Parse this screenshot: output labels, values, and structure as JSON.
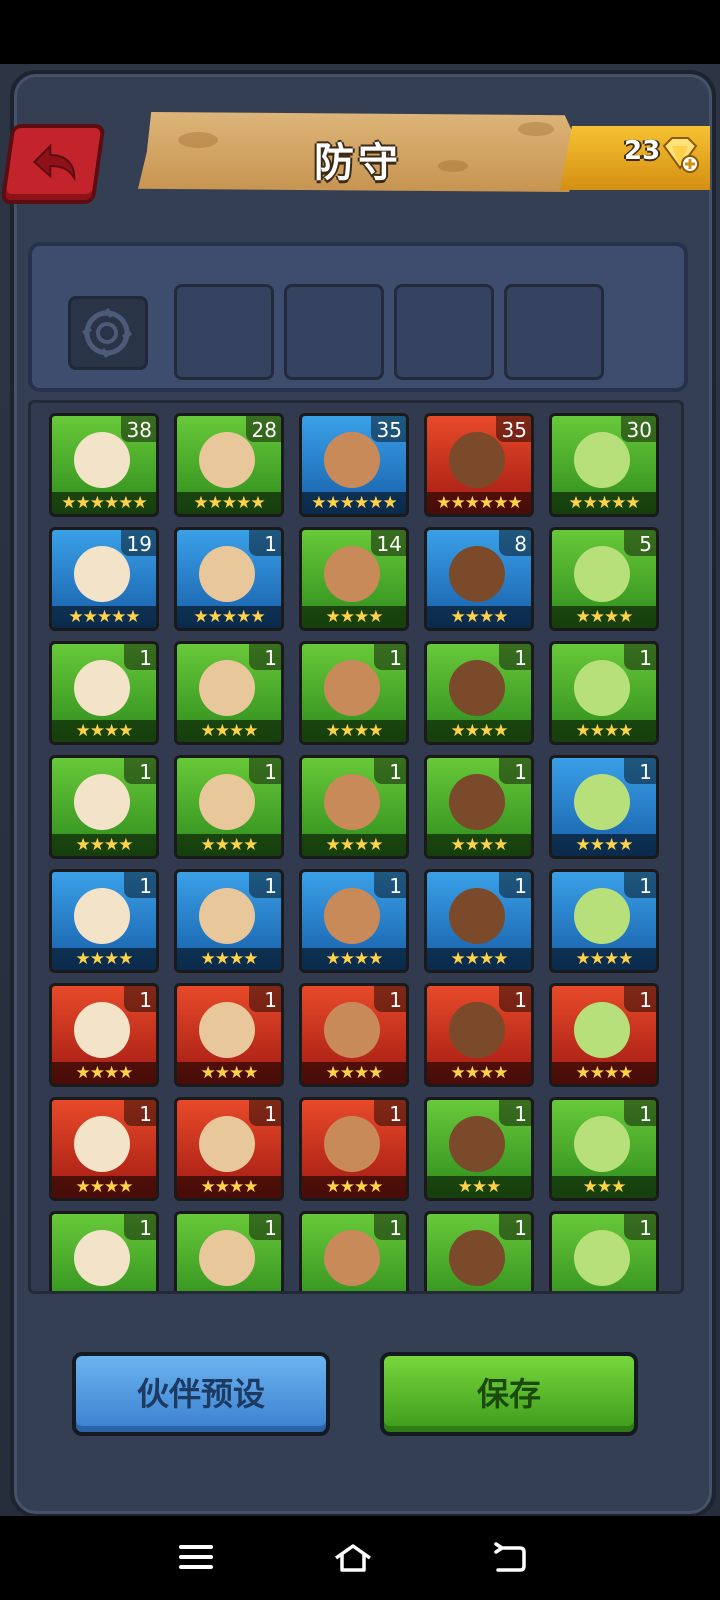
{
  "header": {
    "title": "防守",
    "gems": "23"
  },
  "buttons": {
    "preset": "伙伴预设",
    "save": "保存"
  },
  "colors": {
    "green": "#49ab2a",
    "blue": "#2a7ccf",
    "red": "#c8301e",
    "star": "#ffd24a"
  },
  "heroes": [
    {
      "level": "38",
      "stars": "★★★★★★",
      "bg": "green"
    },
    {
      "level": "28",
      "stars": "★★★★★",
      "bg": "green"
    },
    {
      "level": "35",
      "stars": "★★★★★★",
      "bg": "blue"
    },
    {
      "level": "35",
      "stars": "★★★★★★",
      "bg": "red"
    },
    {
      "level": "30",
      "stars": "★★★★★",
      "bg": "green"
    },
    {
      "level": "19",
      "stars": "★★★★★",
      "bg": "blue"
    },
    {
      "level": "1",
      "stars": "★★★★★",
      "bg": "blue"
    },
    {
      "level": "14",
      "stars": "★★★★",
      "bg": "green"
    },
    {
      "level": "8",
      "stars": "★★★★",
      "bg": "blue"
    },
    {
      "level": "5",
      "stars": "★★★★",
      "bg": "green"
    },
    {
      "level": "1",
      "stars": "★★★★",
      "bg": "green"
    },
    {
      "level": "1",
      "stars": "★★★★",
      "bg": "green"
    },
    {
      "level": "1",
      "stars": "★★★★",
      "bg": "green"
    },
    {
      "level": "1",
      "stars": "★★★★",
      "bg": "green"
    },
    {
      "level": "1",
      "stars": "★★★★",
      "bg": "green"
    },
    {
      "level": "1",
      "stars": "★★★★",
      "bg": "green"
    },
    {
      "level": "1",
      "stars": "★★★★",
      "bg": "green"
    },
    {
      "level": "1",
      "stars": "★★★★",
      "bg": "green"
    },
    {
      "level": "1",
      "stars": "★★★★",
      "bg": "green"
    },
    {
      "level": "1",
      "stars": "★★★★",
      "bg": "blue"
    },
    {
      "level": "1",
      "stars": "★★★★",
      "bg": "blue"
    },
    {
      "level": "1",
      "stars": "★★★★",
      "bg": "blue"
    },
    {
      "level": "1",
      "stars": "★★★★",
      "bg": "blue"
    },
    {
      "level": "1",
      "stars": "★★★★",
      "bg": "blue"
    },
    {
      "level": "1",
      "stars": "★★★★",
      "bg": "blue"
    },
    {
      "level": "1",
      "stars": "★★★★",
      "bg": "red"
    },
    {
      "level": "1",
      "stars": "★★★★",
      "bg": "red"
    },
    {
      "level": "1",
      "stars": "★★★★",
      "bg": "red"
    },
    {
      "level": "1",
      "stars": "★★★★",
      "bg": "red"
    },
    {
      "level": "1",
      "stars": "★★★★",
      "bg": "red"
    },
    {
      "level": "1",
      "stars": "★★★★",
      "bg": "red"
    },
    {
      "level": "1",
      "stars": "★★★★",
      "bg": "red"
    },
    {
      "level": "1",
      "stars": "★★★★",
      "bg": "red"
    },
    {
      "level": "1",
      "stars": "★★★",
      "bg": "green"
    },
    {
      "level": "1",
      "stars": "★★★",
      "bg": "green"
    },
    {
      "level": "1",
      "stars": "",
      "bg": "green"
    },
    {
      "level": "1",
      "stars": "",
      "bg": "green"
    },
    {
      "level": "1",
      "stars": "",
      "bg": "green"
    },
    {
      "level": "1",
      "stars": "",
      "bg": "green"
    },
    {
      "level": "1",
      "stars": "",
      "bg": "green"
    }
  ]
}
